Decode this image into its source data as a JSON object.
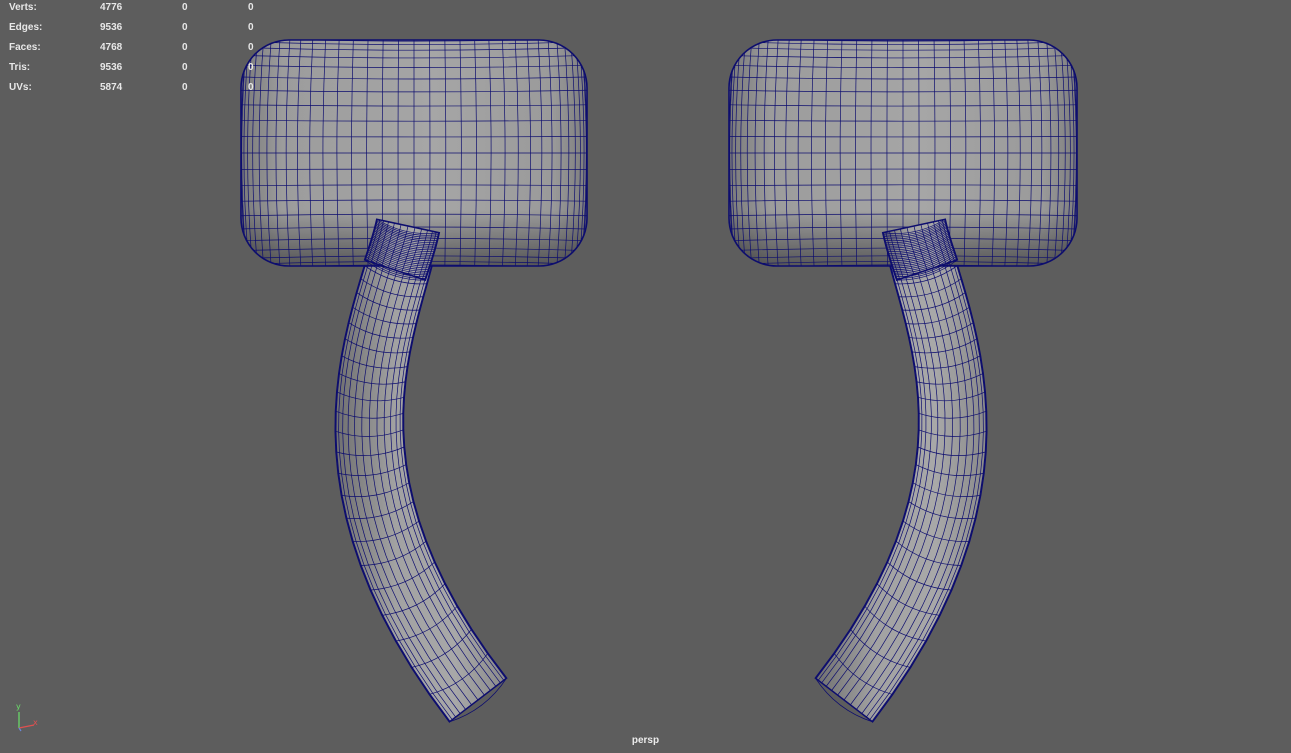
{
  "hud": {
    "rows": [
      {
        "label": "Verts:",
        "v1": "4776",
        "v2": "0",
        "v3": "0"
      },
      {
        "label": "Edges:",
        "v1": "9536",
        "v2": "0",
        "v3": "0"
      },
      {
        "label": "Faces:",
        "v1": "4768",
        "v2": "0",
        "v3": "0"
      },
      {
        "label": "Tris:",
        "v1": "9536",
        "v2": "0",
        "v3": "0"
      },
      {
        "label": "UVs:",
        "v1": "5874",
        "v2": "0",
        "v3": "0"
      }
    ]
  },
  "viewport": {
    "camera_name": "persp",
    "background_color": "#5d5d5d",
    "wire_color": "#0d0d6e",
    "surface_color": "#9a9a9a"
  },
  "axis_gizmo": {
    "y_label": "y",
    "x_label": "x",
    "y_color": "#6ae06a",
    "x_color": "#e05050",
    "z_color": "#6a8ae0"
  }
}
